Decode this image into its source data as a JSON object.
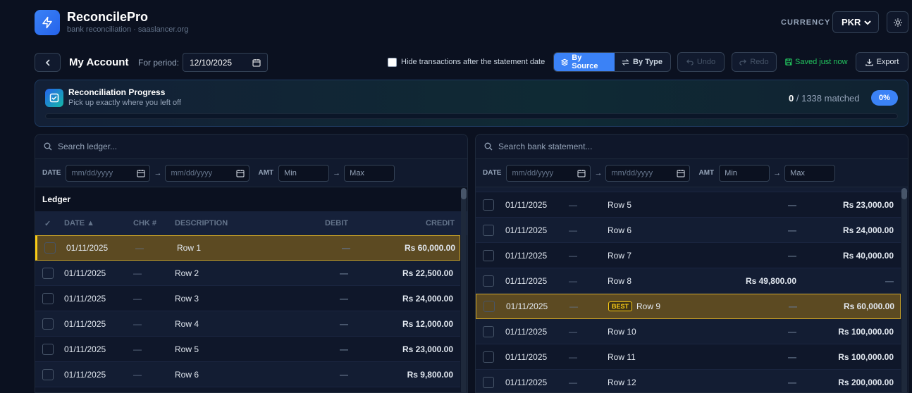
{
  "app": {
    "title": "ReconcilePro",
    "subtitle": "bank reconciliation · saaslancer.org",
    "currency_label": "CURRENCY",
    "currency_value": "PKR"
  },
  "toolbar": {
    "account": "My Account",
    "period_label": "For period:",
    "period_value": "12/10/2025",
    "hide_label": "Hide transactions after the statement date",
    "by_source": "By Source",
    "by_type": "By Type",
    "undo": "Undo",
    "redo": "Redo",
    "saved": "Saved just now",
    "export": "Export"
  },
  "progress": {
    "title": "Reconciliation Progress",
    "subtitle": "Pick up exactly where you left off",
    "matched": "0",
    "total_text": "/ 1338 matched",
    "percent_label": "0%",
    "fraction": 0
  },
  "ledger": {
    "search_placeholder": "Search ledger...",
    "date_label": "DATE",
    "amt_label": "AMT",
    "date_placeholder": "mm/dd/yyyy",
    "min": "Min",
    "max": "Max",
    "title": "Ledger",
    "columns": {
      "check": "✓",
      "date": "DATE ▲",
      "chk": "CHK #",
      "desc": "DESCRIPTION",
      "debit": "DEBIT",
      "credit": "CREDIT"
    },
    "rows": [
      {
        "date": "01/11/2025",
        "chk": "—",
        "desc": "Row 1",
        "debit": "—",
        "credit": "Rs 60,000.00"
      },
      {
        "date": "01/11/2025",
        "chk": "—",
        "desc": "Row 2",
        "debit": "—",
        "credit": "Rs 22,500.00"
      },
      {
        "date": "01/11/2025",
        "chk": "—",
        "desc": "Row 3",
        "debit": "—",
        "credit": "Rs 24,000.00"
      },
      {
        "date": "01/11/2025",
        "chk": "—",
        "desc": "Row 4",
        "debit": "—",
        "credit": "Rs 12,000.00"
      },
      {
        "date": "01/11/2025",
        "chk": "—",
        "desc": "Row 5",
        "debit": "—",
        "credit": "Rs 23,000.00"
      },
      {
        "date": "01/11/2025",
        "chk": "—",
        "desc": "Row 6",
        "debit": "—",
        "credit": "Rs 9,800.00"
      }
    ]
  },
  "bank": {
    "search_placeholder": "Search bank statement...",
    "date_label": "DATE",
    "amt_label": "AMT",
    "date_placeholder": "mm/dd/yyyy",
    "min": "Min",
    "max": "Max",
    "best_badge": "BEST",
    "rows": [
      {
        "date": "01/11/2025",
        "ref": "—",
        "desc": "Row 5",
        "debit": "—",
        "credit": "Rs 23,000.00"
      },
      {
        "date": "01/11/2025",
        "ref": "—",
        "desc": "Row 6",
        "debit": "—",
        "credit": "Rs 24,000.00"
      },
      {
        "date": "01/11/2025",
        "ref": "—",
        "desc": "Row 7",
        "debit": "—",
        "credit": "Rs 40,000.00"
      },
      {
        "date": "01/11/2025",
        "ref": "—",
        "desc": "Row 8",
        "debit": "Rs 49,800.00",
        "credit": "—"
      },
      {
        "date": "01/11/2025",
        "ref": "—",
        "desc": "Row 9",
        "debit": "—",
        "credit": "Rs 60,000.00"
      },
      {
        "date": "01/11/2025",
        "ref": "—",
        "desc": "Row 10",
        "debit": "—",
        "credit": "Rs 100,000.00"
      },
      {
        "date": "01/11/2025",
        "ref": "—",
        "desc": "Row 11",
        "debit": "—",
        "credit": "Rs 100,000.00"
      },
      {
        "date": "01/11/2025",
        "ref": "—",
        "desc": "Row 12",
        "debit": "—",
        "credit": "Rs 200,000.00"
      }
    ]
  }
}
